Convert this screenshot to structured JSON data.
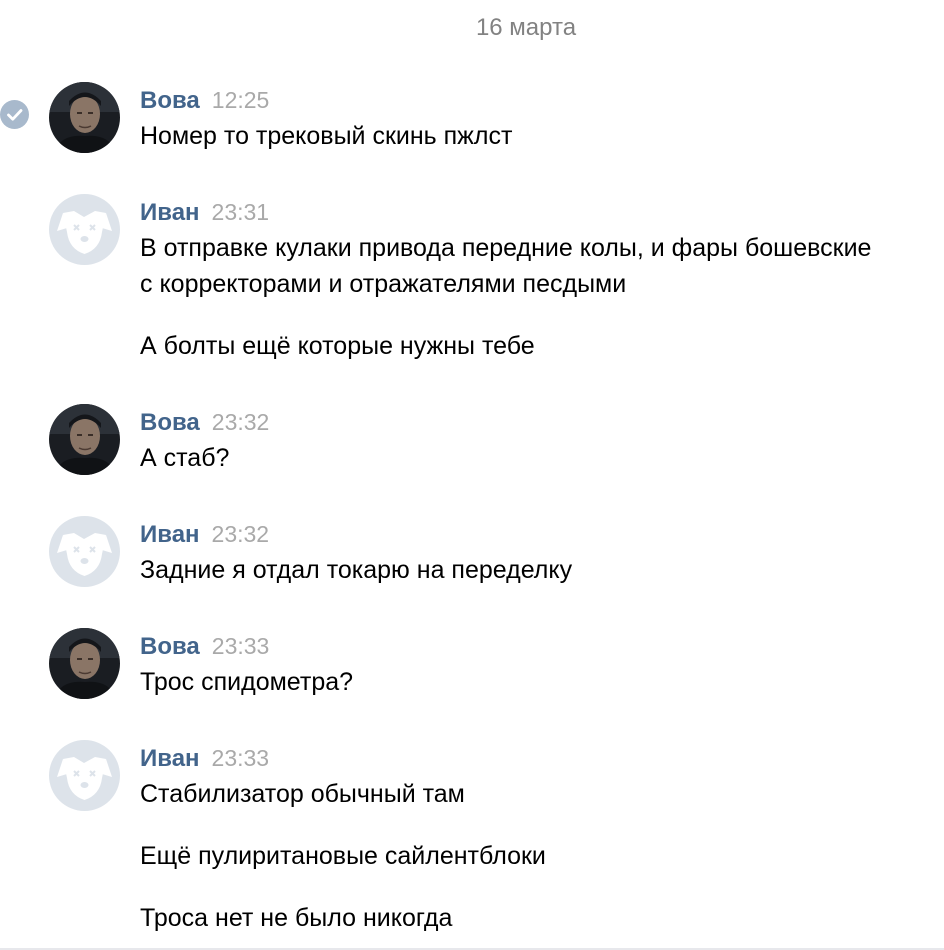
{
  "date_separator": "16 марта",
  "colors": {
    "author": "#42648b",
    "time": "#a9a9a9",
    "text": "#000000",
    "date": "#828282",
    "check_badge": "#a8b9cc",
    "default_avatar_bg": "#dde3ea"
  },
  "messages": [
    {
      "author": "Вова",
      "time": "12:25",
      "avatar": "user-photo",
      "lines": [
        "Номер то трековый скинь пжлст"
      ]
    },
    {
      "author": "Иван",
      "time": "23:31",
      "avatar": "default-dog-avatar",
      "lines": [
        "В отправке кулаки привода передние колы, и фары бошевские",
        "с корректорами и отражателями песдыми",
        "А болты ещё которые нужны тебе"
      ]
    },
    {
      "author": "Вова",
      "time": "23:32",
      "avatar": "user-photo",
      "lines": [
        "А стаб?"
      ]
    },
    {
      "author": "Иван",
      "time": "23:32",
      "avatar": "default-dog-avatar",
      "lines": [
        "Задние я отдал токарю на переделку"
      ]
    },
    {
      "author": "Вова",
      "time": "23:33",
      "avatar": "user-photo",
      "lines": [
        "Трос спидометра?"
      ]
    },
    {
      "author": "Иван",
      "time": "23:33",
      "avatar": "default-dog-avatar",
      "lines": [
        "Стабилизатор обычный там",
        "Ещё пулиритановые сайлентблоки",
        "Троса нет не было никогда"
      ]
    }
  ]
}
